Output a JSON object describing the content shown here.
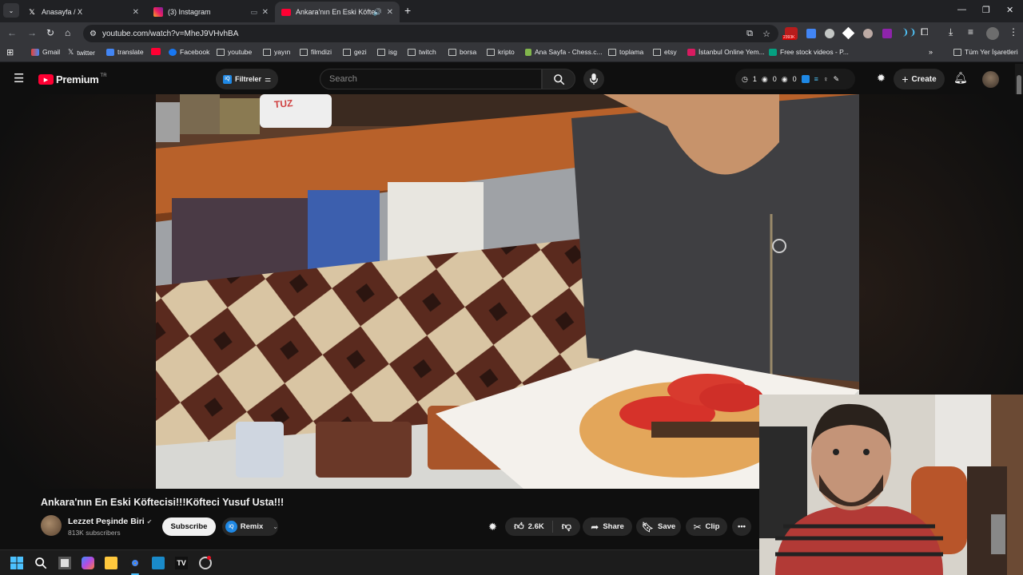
{
  "browser": {
    "tabs": [
      {
        "title": "Anasayfa / X",
        "favicon": "x-logo-icon"
      },
      {
        "title": "(3) Instagram",
        "favicon": "instagram-icon"
      },
      {
        "title": "Ankara'nın En Eski Köftecisi",
        "favicon": "youtube-icon",
        "active": true
      }
    ],
    "url": "youtube.com/watch?v=MheJ9VHvhBA",
    "extension_badge": "2393K"
  },
  "bookmarks": {
    "items": [
      "Gmail",
      "twitter",
      "translate",
      "Facebook",
      "youtube",
      "yayın",
      "filmdizi",
      "gezi",
      "isg",
      "twitch",
      "borsa",
      "kripto",
      "Ana Sayfa - Chess.c...",
      "toplama",
      "etsy",
      "İstanbul Online Yem...",
      "Free stock videos - P..."
    ],
    "all_bookmarks": "Tüm Yer İşaretleri"
  },
  "yt_header": {
    "logo_text": "Premium",
    "region": "TR",
    "filters_label": "Filtreler",
    "search_placeholder": "Search",
    "stats": [
      "1",
      "0",
      "0"
    ],
    "create_label": "Create"
  },
  "video": {
    "title": "Ankara'nın En Eski Köftecisi!!!Köfteci Yusuf Usta!!!",
    "channel": "Lezzet Peşinde Biri",
    "subscribers": "813K subscribers",
    "subscribe_label": "Subscribe",
    "remix_label": "Remix",
    "likes": "2.6K",
    "share_label": "Share",
    "save_label": "Save",
    "clip_label": "Clip",
    "scene_sign": "TUZ"
  }
}
